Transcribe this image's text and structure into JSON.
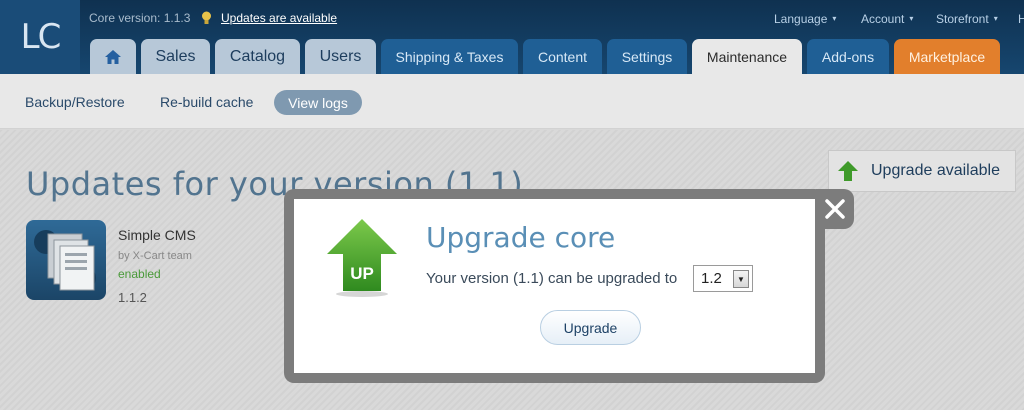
{
  "header": {
    "logo": "LC",
    "core_version": "Core version: 1.1.3",
    "updates_link": "Updates are available",
    "menu": {
      "language": "Language",
      "account": "Account",
      "storefront": "Storefront",
      "cut": "H"
    },
    "caret": "▾"
  },
  "tabs": [
    {
      "label": ""
    },
    {
      "label": "Sales"
    },
    {
      "label": "Catalog"
    },
    {
      "label": "Users"
    },
    {
      "label": "Shipping & Taxes"
    },
    {
      "label": "Content"
    },
    {
      "label": "Settings"
    },
    {
      "label": "Maintenance"
    },
    {
      "label": "Add-ons"
    },
    {
      "label": "Marketplace"
    }
  ],
  "subnav": [
    {
      "label": "Backup/Restore"
    },
    {
      "label": "Re-build cache"
    },
    {
      "label": "View logs"
    }
  ],
  "main": {
    "title": "Updates for your version (1.1)",
    "upgrade_available": "Upgrade available",
    "module": {
      "name": "Simple CMS",
      "author": "by X-Cart team",
      "status": "enabled",
      "version": "1.1.2"
    }
  },
  "modal": {
    "icon_text": "UP",
    "title": "Upgrade core",
    "text": "Your version (1.1) can be upgraded to",
    "selected_version": "1.2",
    "upgrade_button": "Upgrade"
  },
  "colors": {
    "header_bg": "#0f3150",
    "tab_blue": "#1f5f95",
    "tab_orange": "#e27f2c",
    "title_blue": "#52748f",
    "up_green": "#3f9a2a"
  }
}
